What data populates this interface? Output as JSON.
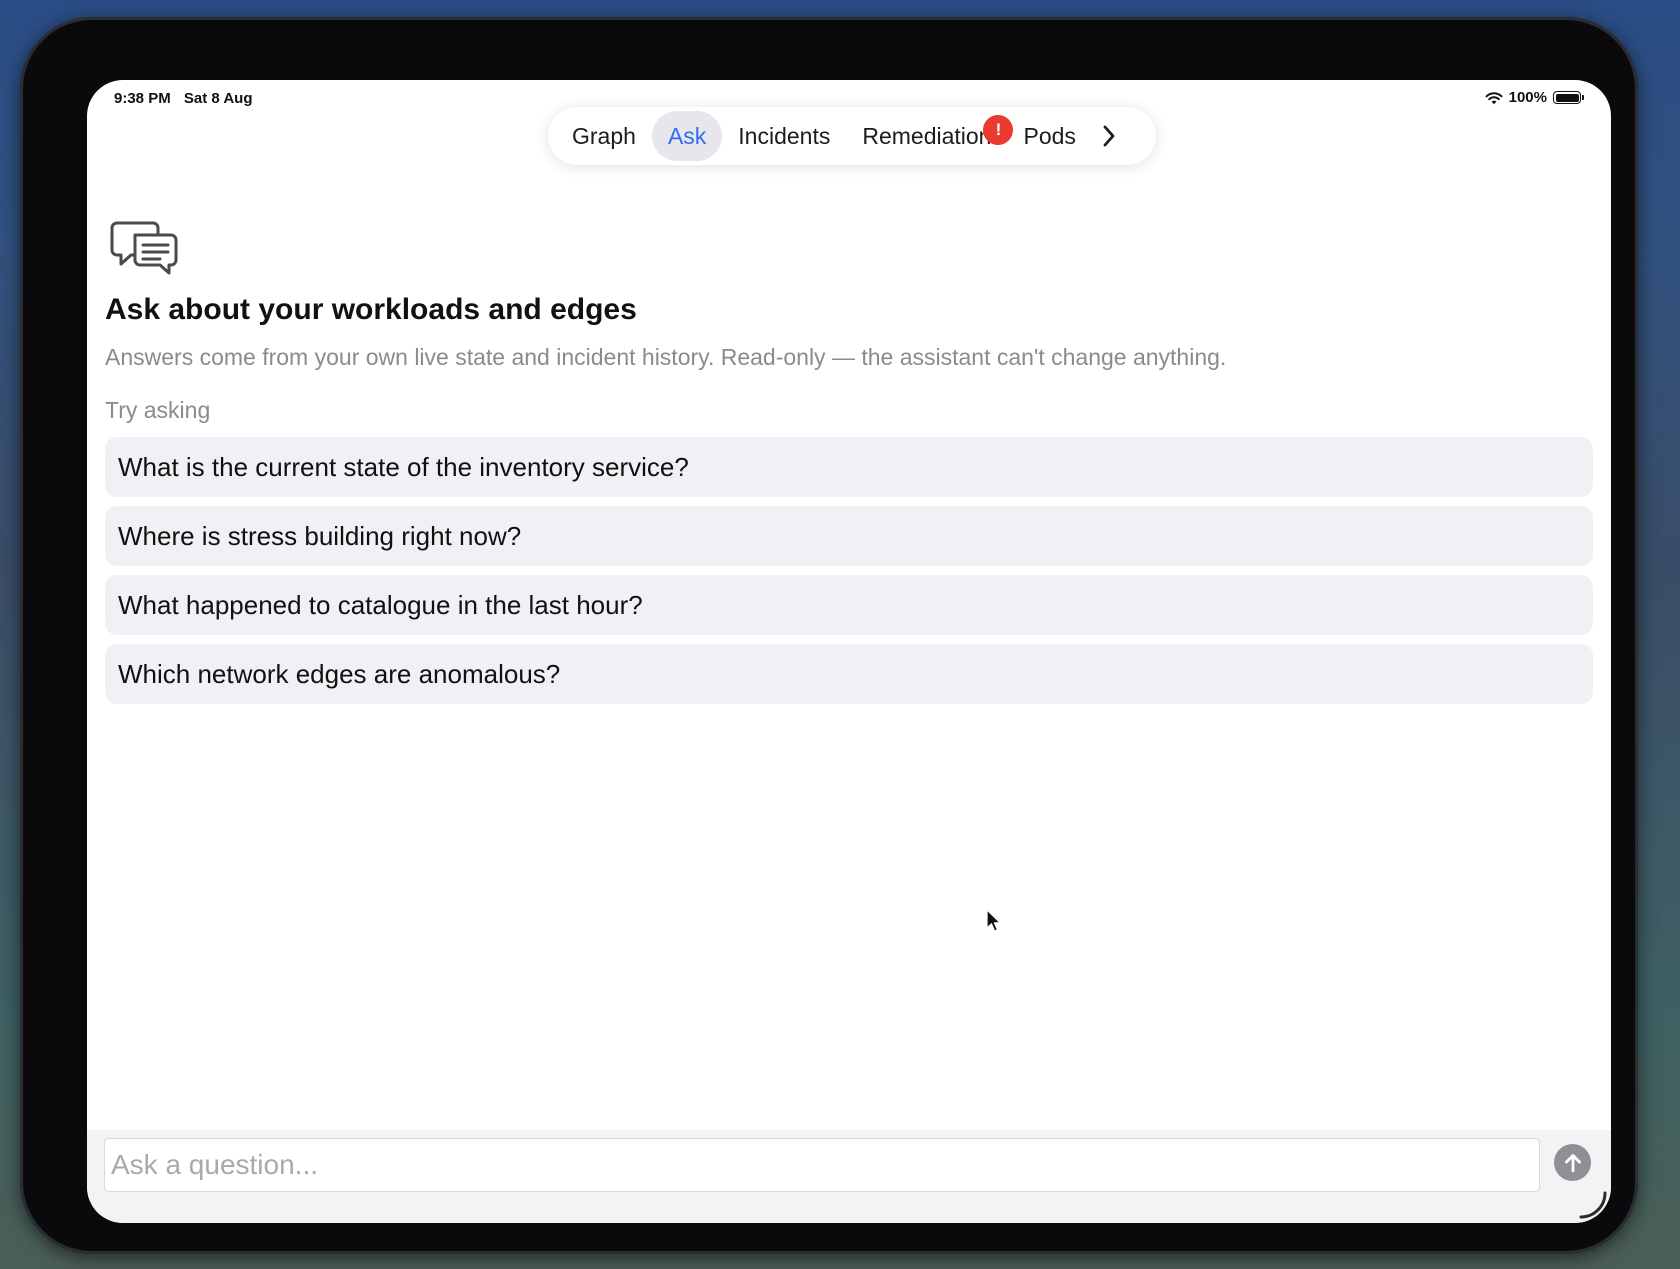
{
  "status_bar": {
    "time": "9:38 PM",
    "date": "Sat 8 Aug",
    "battery": "100%",
    "icons": [
      "wifi-icon",
      "battery-icon"
    ]
  },
  "tabs": [
    {
      "label": "Graph",
      "active": false
    },
    {
      "label": "Ask",
      "active": true
    },
    {
      "label": "Incidents",
      "active": false
    },
    {
      "label": "Remediation",
      "active": false,
      "badge": "!"
    },
    {
      "label": "Pods",
      "active": false
    }
  ],
  "tab_more_icon": "chevron-right-icon",
  "colors": {
    "accent": "#2f6df0",
    "badge": "#ea3a31",
    "muted_text": "#8a8a8f",
    "suggestion_bg": "#f1f1f5"
  },
  "main": {
    "icon": "chat-bubbles-icon",
    "title": "Ask about your workloads and edges",
    "subtitle": "Answers come from your own live state and incident history. Read-only — the assistant can't change anything.",
    "try_label": "Try asking",
    "suggestions": [
      "What is the current state of the inventory service?",
      "Where is stress building right now?",
      "What happened to catalogue in the last hour?",
      "Which network edges are anomalous?"
    ]
  },
  "composer": {
    "placeholder": "Ask a question...",
    "value": "",
    "send_icon": "arrow-up-icon"
  }
}
